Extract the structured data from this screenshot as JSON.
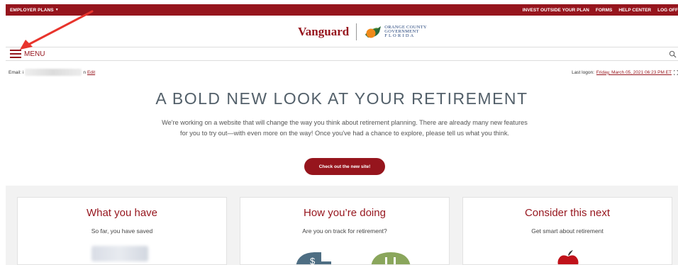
{
  "topbar": {
    "employer_plans": "EMPLOYER PLANS",
    "links": [
      "INVEST OUTSIDE YOUR PLAN",
      "FORMS",
      "HELP CENTER",
      "LOG OFF"
    ]
  },
  "logos": {
    "vanguard": "Vanguard",
    "oc_line1": "ORANGE COUNTY",
    "oc_line2": "GOVERNMENT",
    "oc_line3": "F L O R I D A"
  },
  "menu": {
    "label": "MENU"
  },
  "account": {
    "email_label": "Email: i",
    "email_suffix": "n",
    "edit_label": "Edit",
    "last_logon_label": "Last logon:",
    "last_logon_value": "Friday, March 05, 2021 06:23 PM ET"
  },
  "hero": {
    "title": "A BOLD NEW LOOK AT YOUR RETIREMENT",
    "description": "We're working on a website that will change the way you think about retirement planning. There are already many new features for you to try out—with even more on the way! Once you've had a chance to explore, please tell us what you think.",
    "cta_label": "Check out the new site!"
  },
  "cards": [
    {
      "title": "What you have",
      "subtitle": "So far, you have saved"
    },
    {
      "title": "How you’re doing",
      "subtitle": "Are you on track for retirement?"
    },
    {
      "title": "Consider this next",
      "subtitle": "Get smart about retirement"
    }
  ],
  "colors": {
    "brand": "#96151d",
    "slate": "#4e6e83",
    "green": "#8aa65c",
    "annotation": "#e8342c"
  }
}
